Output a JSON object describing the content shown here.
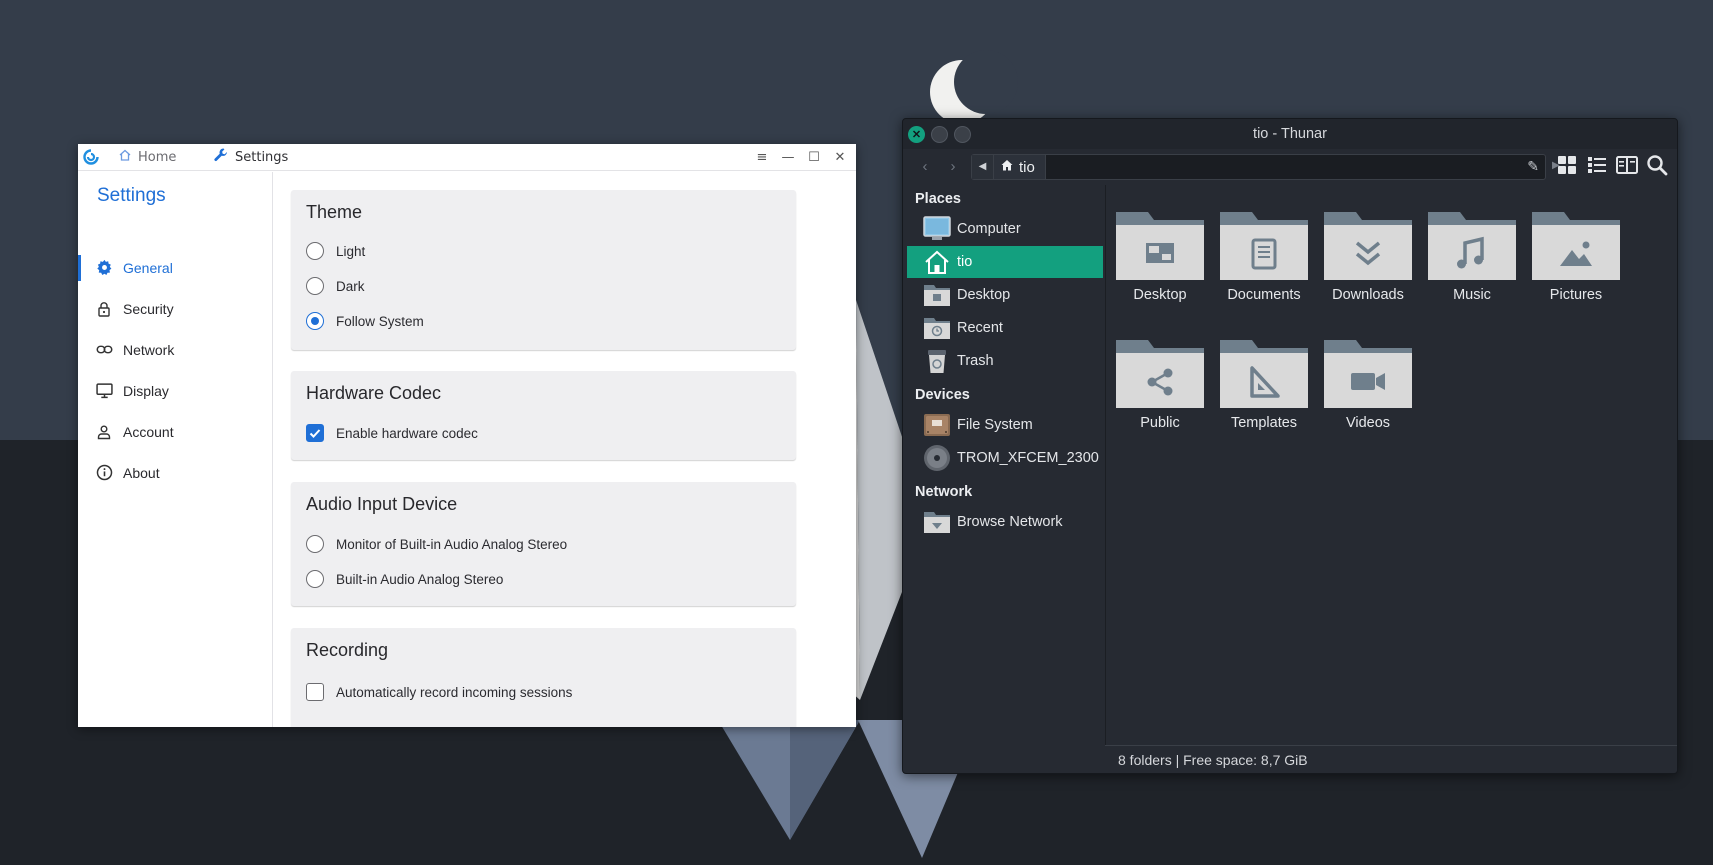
{
  "settings_window": {
    "tabs": [
      {
        "label": "Home",
        "icon": "home-icon"
      },
      {
        "label": "Settings",
        "icon": "wrench-icon"
      }
    ],
    "title": "Settings",
    "nav": [
      {
        "label": "General",
        "icon": "gear-icon",
        "active": true
      },
      {
        "label": "Security",
        "icon": "lock-icon"
      },
      {
        "label": "Network",
        "icon": "link-icon"
      },
      {
        "label": "Display",
        "icon": "monitor-icon"
      },
      {
        "label": "Account",
        "icon": "user-icon"
      },
      {
        "label": "About",
        "icon": "info-icon"
      }
    ],
    "accent_color": "#1f6fd6",
    "sections": {
      "theme": {
        "title": "Theme",
        "options": [
          "Light",
          "Dark",
          "Follow System"
        ],
        "selected": "Follow System"
      },
      "hardware_codec": {
        "title": "Hardware Codec",
        "checkbox_label": "Enable hardware codec",
        "checked": true
      },
      "audio_input": {
        "title": "Audio Input Device",
        "options": [
          "Monitor of Built-in Audio Analog Stereo",
          "Built-in Audio Analog Stereo"
        ],
        "selected": null
      },
      "recording": {
        "title": "Recording",
        "checkbox_label": "Automatically record incoming sessions",
        "checked": false
      }
    }
  },
  "thunar_window": {
    "title": "tio - Thunar",
    "path_crumb": "tio",
    "accent_color": "#13a07f",
    "sidebar": {
      "places_header": "Places",
      "places": [
        {
          "label": "Computer",
          "icon": "computer-icon"
        },
        {
          "label": "tio",
          "icon": "home-icon",
          "active": true
        },
        {
          "label": "Desktop",
          "icon": "desktop-folder-icon"
        },
        {
          "label": "Recent",
          "icon": "recent-folder-icon"
        },
        {
          "label": "Trash",
          "icon": "trash-icon"
        }
      ],
      "devices_header": "Devices",
      "devices": [
        {
          "label": "File System",
          "icon": "hdd-icon"
        },
        {
          "label": "TROM_XFCEM_2300",
          "icon": "disc-icon"
        }
      ],
      "network_header": "Network",
      "network": [
        {
          "label": "Browse Network",
          "icon": "network-folder-icon"
        }
      ]
    },
    "folders": [
      {
        "label": "Desktop",
        "emblem": "desktop"
      },
      {
        "label": "Documents",
        "emblem": "document"
      },
      {
        "label": "Downloads",
        "emblem": "download"
      },
      {
        "label": "Music",
        "emblem": "music"
      },
      {
        "label": "Pictures",
        "emblem": "picture"
      },
      {
        "label": "Public",
        "emblem": "share"
      },
      {
        "label": "Templates",
        "emblem": "template"
      },
      {
        "label": "Videos",
        "emblem": "video"
      }
    ],
    "status": "8 folders  |  Free space: 8,7 GiB"
  }
}
